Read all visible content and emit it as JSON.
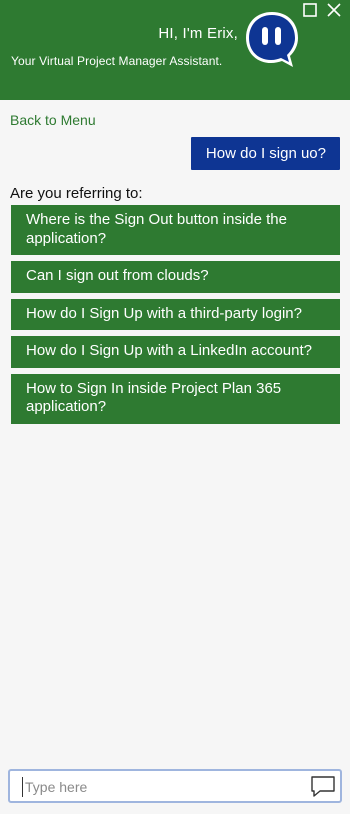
{
  "header": {
    "greeting": "HI, I'm Erix,",
    "subtitle": "Your Virtual Project Manager Assistant.",
    "avatar_icon": "chat-bot-icon",
    "restore_icon": "restore-window-icon",
    "close_icon": "close-icon",
    "brand_color": "#2e7a31"
  },
  "nav": {
    "back_label": "Back to Menu"
  },
  "chat": {
    "user_message": "How do I sign uo?",
    "user_bubble_color": "#0e3593",
    "prompt": "Are you referring to:",
    "options": [
      "Where is the Sign Out button inside the application?",
      "Can I sign out from clouds?",
      "How do I Sign Up with a third-party login?",
      "How do I Sign Up with a LinkedIn account?",
      "How to Sign In inside Project Plan 365 application?"
    ]
  },
  "input": {
    "placeholder": "Type here",
    "send_icon": "chat-bubble-icon"
  }
}
